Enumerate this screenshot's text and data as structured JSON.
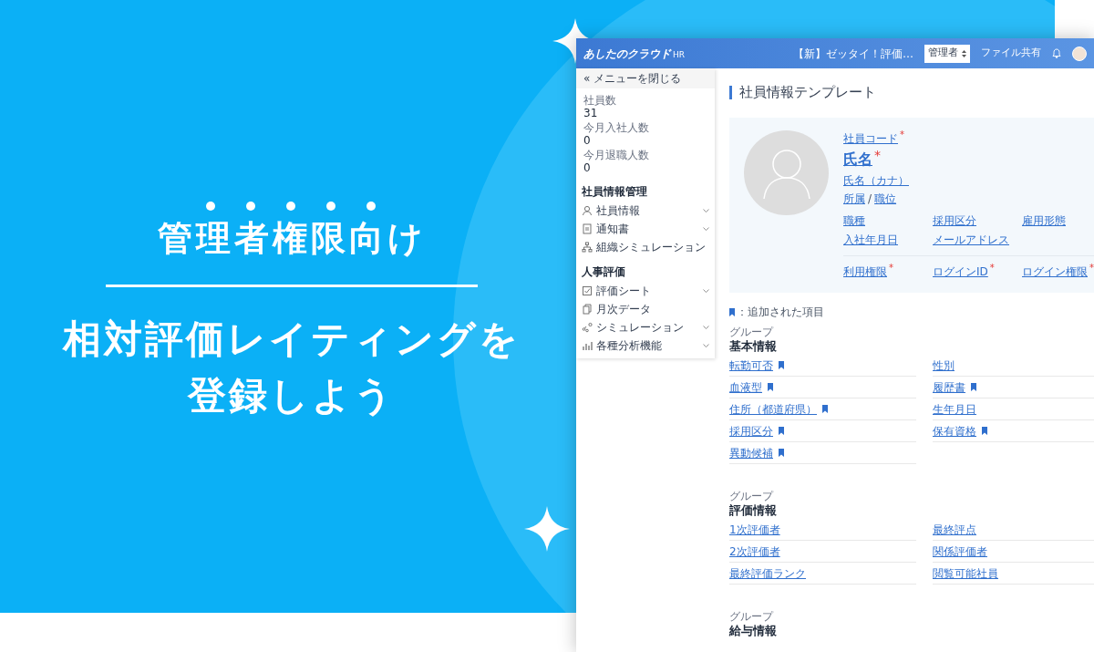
{
  "banner": {
    "tagline": "管理者権限向け",
    "headline": [
      "相対評価レイティングを",
      "登録しよう"
    ]
  },
  "app": {
    "logo": "あしたのクラウド",
    "logo_suffix": "HR",
    "notice": "【新】ゼッタイ！評価…",
    "role_select": "管理者",
    "file_share": "ファイル共有",
    "sidebar": {
      "close_icon": "«",
      "close": "メニューを閉じる",
      "stats": [
        {
          "label": "社員数",
          "value": "31"
        },
        {
          "label": "今月入社人数",
          "value": "0"
        },
        {
          "label": "今月退職人数",
          "value": "0"
        }
      ],
      "sections": [
        {
          "title": "社員情報管理",
          "items": [
            {
              "label": "社員情報",
              "expandable": true
            },
            {
              "label": "通知書",
              "expandable": true
            },
            {
              "label": "組織シミュレーション",
              "expandable": false
            }
          ]
        },
        {
          "title": "人事評価",
          "items": [
            {
              "label": "評価シート",
              "expandable": true
            },
            {
              "label": "月次データ",
              "expandable": false
            },
            {
              "label": "シミュレーション",
              "expandable": true
            },
            {
              "label": "各種分析機能",
              "expandable": true
            }
          ]
        }
      ]
    },
    "page_title": "社員情報テンプレート",
    "profile": {
      "code": {
        "label": "社員コード",
        "mark": "*"
      },
      "name": {
        "label": "氏名",
        "mark": "*"
      },
      "kana": "氏名（カナ）",
      "dept": "所属",
      "separator": "/",
      "position": "職位",
      "fields": [
        {
          "label": "職種"
        },
        {
          "label": "採用区分"
        },
        {
          "label": "雇用形態"
        },
        {
          "label": "入社年月日"
        },
        {
          "label": "メールアドレス"
        }
      ],
      "login_fields": [
        {
          "label": "利用権限",
          "mark": "*"
        },
        {
          "label": "ログインID",
          "mark": "*"
        },
        {
          "label": "ログイン権限",
          "mark": "*"
        }
      ]
    },
    "legend": "：追加された項目",
    "groups": [
      {
        "caption": "グループ",
        "title": "基本情報",
        "fields": [
          {
            "label": "転勤可否",
            "added": true
          },
          {
            "label": "性別",
            "added": false
          },
          {
            "label": "血液型",
            "added": true
          },
          {
            "label": "履歴書",
            "added": true
          },
          {
            "label": "住所（都道府県）",
            "added": true
          },
          {
            "label": "生年月日",
            "added": false
          },
          {
            "label": "採用区分",
            "added": true
          },
          {
            "label": "保有資格",
            "added": true
          },
          {
            "label": "異動候補",
            "added": true
          }
        ]
      },
      {
        "caption": "グループ",
        "title": "評価情報",
        "fields": [
          {
            "label": "1次評価者",
            "added": false
          },
          {
            "label": "最終評点",
            "added": false
          },
          {
            "label": "2次評価者",
            "added": false
          },
          {
            "label": "関係評価者",
            "added": false
          },
          {
            "label": "最終評価ランク",
            "added": false
          },
          {
            "label": "閲覧可能社員",
            "added": false
          }
        ]
      },
      {
        "caption": "グループ",
        "title": "給与情報"
      }
    ]
  }
}
